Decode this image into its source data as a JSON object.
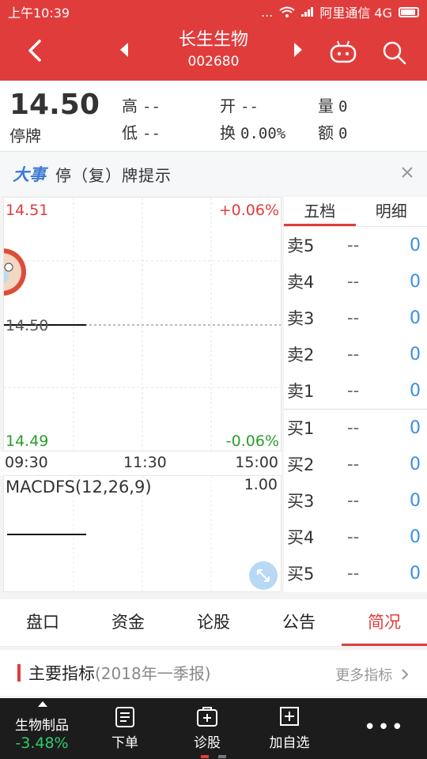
{
  "status_bar": {
    "time": "上午10:39",
    "carrier": "阿里通信 4G",
    "dots": "..."
  },
  "header": {
    "stock_name": "长生生物",
    "stock_code": "002680"
  },
  "quote": {
    "price": "14.50",
    "status": "停牌",
    "high_label": "高",
    "high_value": "--",
    "low_label": "低",
    "low_value": "--",
    "open_label": "开",
    "open_value": "--",
    "turnover_label": "换",
    "turnover_value": "0.00%",
    "volume_label": "量",
    "volume_value": "0",
    "amount_label": "额",
    "amount_value": "0"
  },
  "notice": {
    "badge": "大事",
    "text": "停（复）牌提示"
  },
  "chart": {
    "top_price": "14.51",
    "top_pct": "+0.06%",
    "mid_price": "14.50",
    "bottom_price": "14.49",
    "bottom_pct": "-0.06%",
    "times": [
      "09:30",
      "11:30",
      "15:00"
    ],
    "macd_label": "MACDFS(12,26,9)",
    "macd_max": "1.00"
  },
  "order_book": {
    "tabs": [
      "五档",
      "明细"
    ],
    "sells": [
      {
        "label": "卖5",
        "price": "--",
        "qty": "0"
      },
      {
        "label": "卖4",
        "price": "--",
        "qty": "0"
      },
      {
        "label": "卖3",
        "price": "--",
        "qty": "0"
      },
      {
        "label": "卖2",
        "price": "--",
        "qty": "0"
      },
      {
        "label": "卖1",
        "price": "--",
        "qty": "0"
      }
    ],
    "buys": [
      {
        "label": "买1",
        "price": "--",
        "qty": "0"
      },
      {
        "label": "买2",
        "price": "--",
        "qty": "0"
      },
      {
        "label": "买3",
        "price": "--",
        "qty": "0"
      },
      {
        "label": "买4",
        "price": "--",
        "qty": "0"
      },
      {
        "label": "买5",
        "price": "--",
        "qty": "0"
      }
    ]
  },
  "tabs": [
    "盘口",
    "资金",
    "论股",
    "公告",
    "简况"
  ],
  "indicators": {
    "title": "主要指标",
    "period": "(2018年一季报)",
    "more": "更多指标"
  },
  "bottom_bar": {
    "sector_name": "生物制品",
    "sector_change": "-3.48%",
    "items": [
      "下单",
      "诊股",
      "加自选"
    ],
    "more": "•••"
  },
  "colors": {
    "brand": "#e13c3c",
    "up": "#e13c3c",
    "down": "#2a9d2a",
    "link": "#3a8ee6"
  }
}
